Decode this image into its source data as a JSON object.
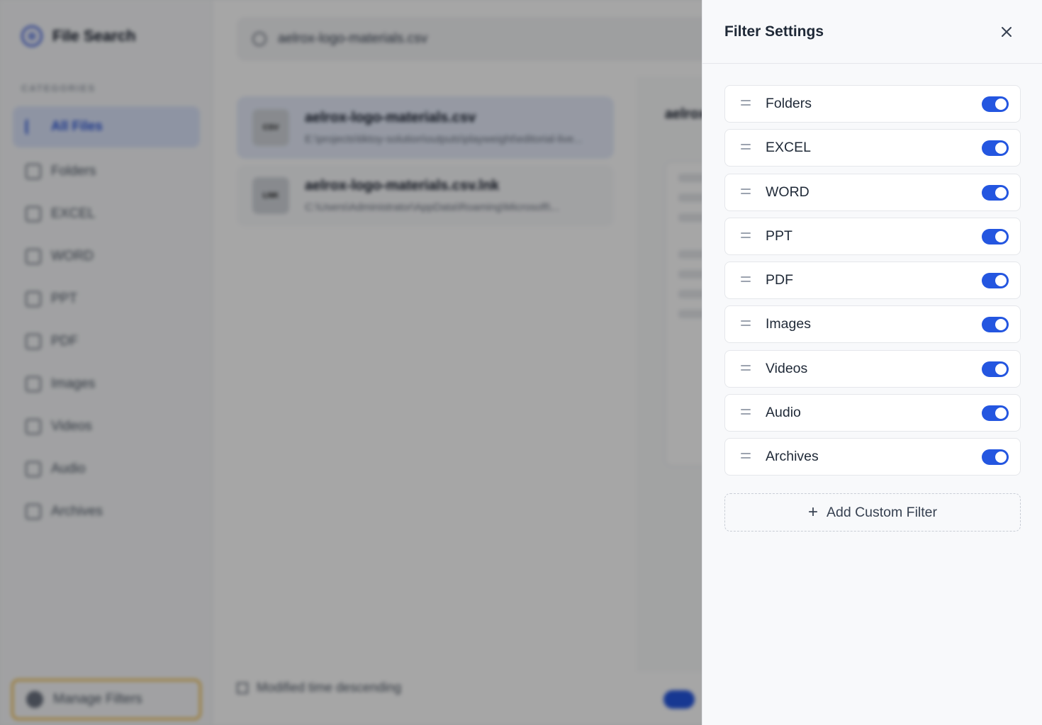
{
  "app": {
    "brand_title": "File Search",
    "categories_heading": "CATEGORIES",
    "nav_items": [
      "All Files",
      "Folders",
      "EXCEL",
      "WORD",
      "PPT",
      "PDF",
      "Images",
      "Videos",
      "Audio",
      "Archives"
    ],
    "manage_filters_label": "Manage Filters",
    "search_value": "aelrox-logo-materials.csv",
    "results": [
      {
        "type": "CSV",
        "name": "aelrox-logo-materials.csv",
        "path": "E:\\projects\\tiktoy-solution\\outputs\\playweight\\editorial-live..."
      },
      {
        "type": "LNK",
        "name": "aelrox-logo-materials.csv.lnk",
        "path": "C:\\Users\\Administrator\\AppData\\Roaming\\Microsoft\\..."
      }
    ],
    "preview_title": "aelrox",
    "sort_label": "Modified time descending"
  },
  "panel": {
    "title": "Filter Settings",
    "filters": [
      {
        "label": "Folders",
        "enabled": true
      },
      {
        "label": "EXCEL",
        "enabled": true
      },
      {
        "label": "WORD",
        "enabled": true
      },
      {
        "label": "PPT",
        "enabled": true
      },
      {
        "label": "PDF",
        "enabled": true
      },
      {
        "label": "Images",
        "enabled": true
      },
      {
        "label": "Videos",
        "enabled": true
      },
      {
        "label": "Audio",
        "enabled": true
      },
      {
        "label": "Archives",
        "enabled": true
      }
    ],
    "add_button_label": "Add Custom Filter"
  },
  "colors": {
    "accent": "#2456e0",
    "highlight_border": "#f0b942"
  }
}
